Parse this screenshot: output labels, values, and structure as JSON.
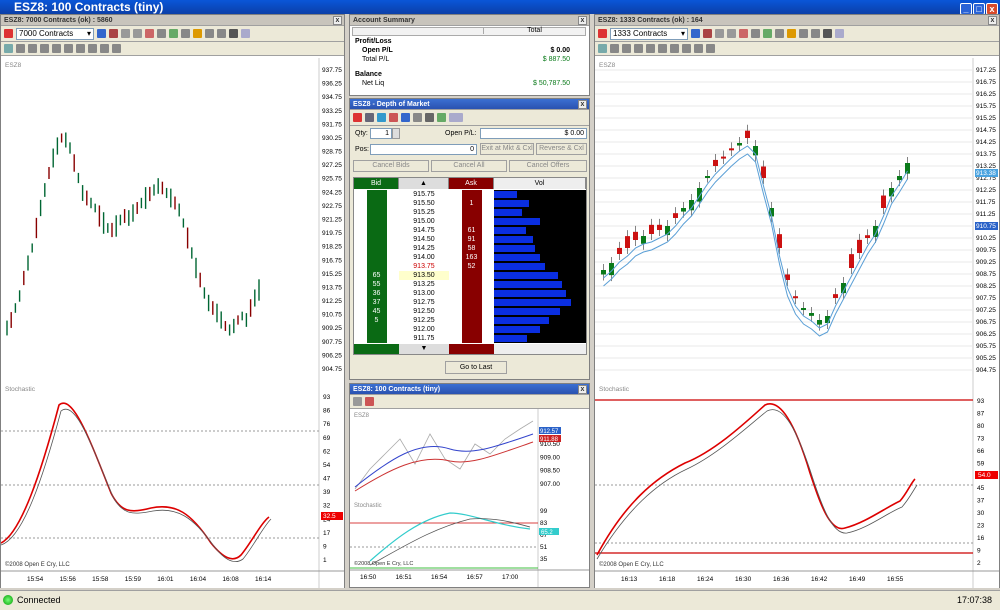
{
  "app": {
    "title": "ESZ8: 100 Contracts (tiny)",
    "win_min": "_",
    "win_max": "□",
    "win_close": "x",
    "panel_close": "x"
  },
  "left_chart": {
    "title": "ESZ8: 7000 Contracts (ok) : 5860",
    "contracts_label": "7000 Contracts",
    "symbol": "ESZ8",
    "price_ticks": [
      "937.75",
      "936.25",
      "934.75",
      "933.25",
      "931.75",
      "930.25",
      "928.75",
      "927.25",
      "925.75",
      "924.25",
      "922.75",
      "921.25",
      "919.75",
      "918.25",
      "916.75",
      "915.25",
      "913.75",
      "912.25",
      "910.75",
      "909.25",
      "907.75",
      "906.25",
      "904.75"
    ],
    "stoch_label": "Stochastic",
    "stoch_ticks": [
      "93",
      "86",
      "76",
      "69",
      "62",
      "54",
      "47",
      "39",
      "32",
      "24",
      "17",
      "9",
      "1"
    ],
    "stoch_marker": "32.5",
    "time_ticks": [
      "15:54",
      "15:56",
      "15:58",
      "15:59",
      "16:01",
      "16:04",
      "16:08",
      "16:14"
    ],
    "copyright": "©2008 Open E Cry, LLC"
  },
  "right_chart": {
    "title": "ESZ8: 1333 Contracts (ok) : 164",
    "contracts_label": "1333 Contracts",
    "symbol": "ESZ8",
    "price_ticks": [
      "917.25",
      "916.75",
      "916.25",
      "915.75",
      "915.25",
      "914.75",
      "914.25",
      "913.75",
      "913.25",
      "912.75",
      "912.25",
      "911.75",
      "911.25",
      "910.75",
      "910.25",
      "909.75",
      "909.25",
      "908.75",
      "908.25",
      "907.75",
      "907.25",
      "906.75",
      "906.25",
      "905.75",
      "905.25",
      "904.75"
    ],
    "price_marker_top": "913.38",
    "price_marker_mid": "910.75",
    "stoch_label": "Stochastic",
    "stoch_ticks": [
      "93",
      "87",
      "80",
      "73",
      "66",
      "59",
      "52",
      "45",
      "37",
      "30",
      "23",
      "16",
      "9",
      "2"
    ],
    "stoch_marker": "54.0",
    "time_ticks": [
      "16:13",
      "16:18",
      "16:24",
      "16:30",
      "16:36",
      "16:42",
      "16:49",
      "16:55"
    ],
    "copyright": "©2008 Open E Cry, LLC"
  },
  "account_summary": {
    "title": "Account Summary",
    "col_total": "Total",
    "profit_loss_header": "Profit/Loss",
    "open_pl_label": "Open P/L",
    "open_pl_value": "$ 0.00",
    "total_pl_label": "Total P/L",
    "total_pl_value": "$ 887.50",
    "balance_header": "Balance",
    "net_liq_label": "Net Liq",
    "net_liq_value": "$ 50,787.50"
  },
  "dom": {
    "title": "ESZ8 - Depth of Market",
    "qty_label": "Qty:",
    "qty_value": "1",
    "open_pl_label": "Open P/L:",
    "open_pl_value": "$ 0.00",
    "pos_label": "Pos:",
    "pos_value": "0",
    "exit_button": "Exit at Mkt & Cxl",
    "reverse_button": "Reverse & Cxl",
    "cancel_bids": "Cancel Bids",
    "cancel_all": "Cancel All",
    "cancel_offers": "Cancel Offers",
    "col_bid": "Bid",
    "col_ask": "Ask",
    "col_vol": "Vol",
    "up_arrow": "▲",
    "down_arrow": "▼",
    "go_to_last": "Go to Last",
    "rows": [
      {
        "price": "915.75",
        "bid": "",
        "ask": "",
        "vol": 0.25
      },
      {
        "price": "915.50",
        "bid": "",
        "ask": "1",
        "vol": 0.38
      },
      {
        "price": "915.25",
        "bid": "",
        "ask": "",
        "vol": 0.3
      },
      {
        "price": "915.00",
        "bid": "",
        "ask": "",
        "vol": 0.5
      },
      {
        "price": "914.75",
        "bid": "",
        "ask": "61",
        "vol": 0.35
      },
      {
        "price": "914.50",
        "bid": "",
        "ask": "91",
        "vol": 0.42
      },
      {
        "price": "914.25",
        "bid": "",
        "ask": "58",
        "vol": 0.45
      },
      {
        "price": "914.00",
        "bid": "",
        "ask": "163",
        "vol": 0.5
      },
      {
        "price": "913.75",
        "bid": "",
        "ask": "52",
        "vol": 0.55
      },
      {
        "price": "913.50",
        "bid": "65",
        "ask": "",
        "vol": 0.7
      },
      {
        "price": "913.25",
        "bid": "55",
        "ask": "",
        "vol": 0.74
      },
      {
        "price": "913.00",
        "bid": "36",
        "ask": "",
        "vol": 0.78
      },
      {
        "price": "912.75",
        "bid": "37",
        "ask": "",
        "vol": 0.84
      },
      {
        "price": "912.50",
        "bid": "45",
        "ask": "",
        "vol": 0.72
      },
      {
        "price": "912.25",
        "bid": "5",
        "ask": "",
        "vol": 0.6
      },
      {
        "price": "912.00",
        "bid": "",
        "ask": "",
        "vol": 0.5
      },
      {
        "price": "911.75",
        "bid": "",
        "ask": "",
        "vol": 0.36
      }
    ]
  },
  "mini_chart": {
    "title": "ESZ8: 100 Contracts (tiny)",
    "symbol": "ESZ8",
    "price_ticks": [
      "910.50",
      "909.00",
      "908.50",
      "907.00"
    ],
    "marker_blue": "912.57",
    "marker_red": "911.88",
    "stoch_label": "Stochastic",
    "stoch_ticks": [
      "99",
      "83",
      "67",
      "51",
      "35"
    ],
    "stoch_marker": "65.2",
    "time_ticks": [
      "16:50",
      "16:51",
      "16:54",
      "16:57",
      "17:00"
    ],
    "copyright": "©2008 Open E Cry, LLC"
  },
  "status": {
    "connection": "Connected",
    "clock": "17:07:38"
  },
  "colors": {
    "up": "#0a7a1a",
    "down": "#cc1111",
    "ma_blue": "#5a9fd6",
    "stoch_red": "#dd0000",
    "bid_green": "#0a6a14",
    "ask_red": "#880000"
  }
}
